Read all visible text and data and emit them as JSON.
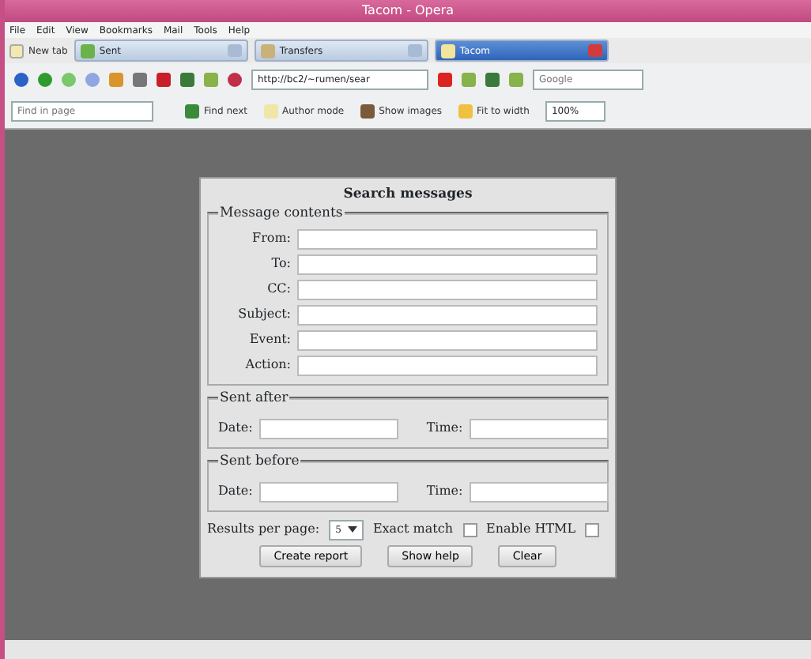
{
  "window": {
    "title": "Tacom - Opera"
  },
  "menu": [
    "File",
    "Edit",
    "View",
    "Bookmarks",
    "Mail",
    "Tools",
    "Help"
  ],
  "new_tab": "New tab",
  "tabs": [
    {
      "label": "Sent",
      "selected": false
    },
    {
      "label": "Transfers",
      "selected": false
    },
    {
      "label": "Tacom",
      "selected": true
    }
  ],
  "address": {
    "value": "http://bc2/~rumen/sear"
  },
  "search": {
    "placeholder": "Google"
  },
  "find_bar": {
    "placeholder": "Find in page",
    "buttons": [
      "Find next",
      "Author mode",
      "Show images",
      "Fit to width"
    ],
    "zoom": "100%"
  },
  "form": {
    "title": "Search messages",
    "groups": [
      {
        "legend": "Message contents",
        "kind": "stack",
        "fields": [
          "From:",
          "To:",
          "CC:",
          "Subject:",
          "Event:",
          "Action:"
        ]
      },
      {
        "legend": "Sent after",
        "kind": "pair",
        "fields": [
          "Date:",
          "Time:"
        ]
      },
      {
        "legend": "Sent before",
        "kind": "pair",
        "fields": [
          "Date:",
          "Time:"
        ]
      }
    ],
    "results_label": "Results per page:",
    "results_value": "5",
    "options": [
      {
        "label": "Exact match",
        "checked": false
      },
      {
        "label": "Enable HTML",
        "checked": false
      }
    ],
    "buttons": [
      "Create report",
      "Show help",
      "Clear"
    ]
  }
}
